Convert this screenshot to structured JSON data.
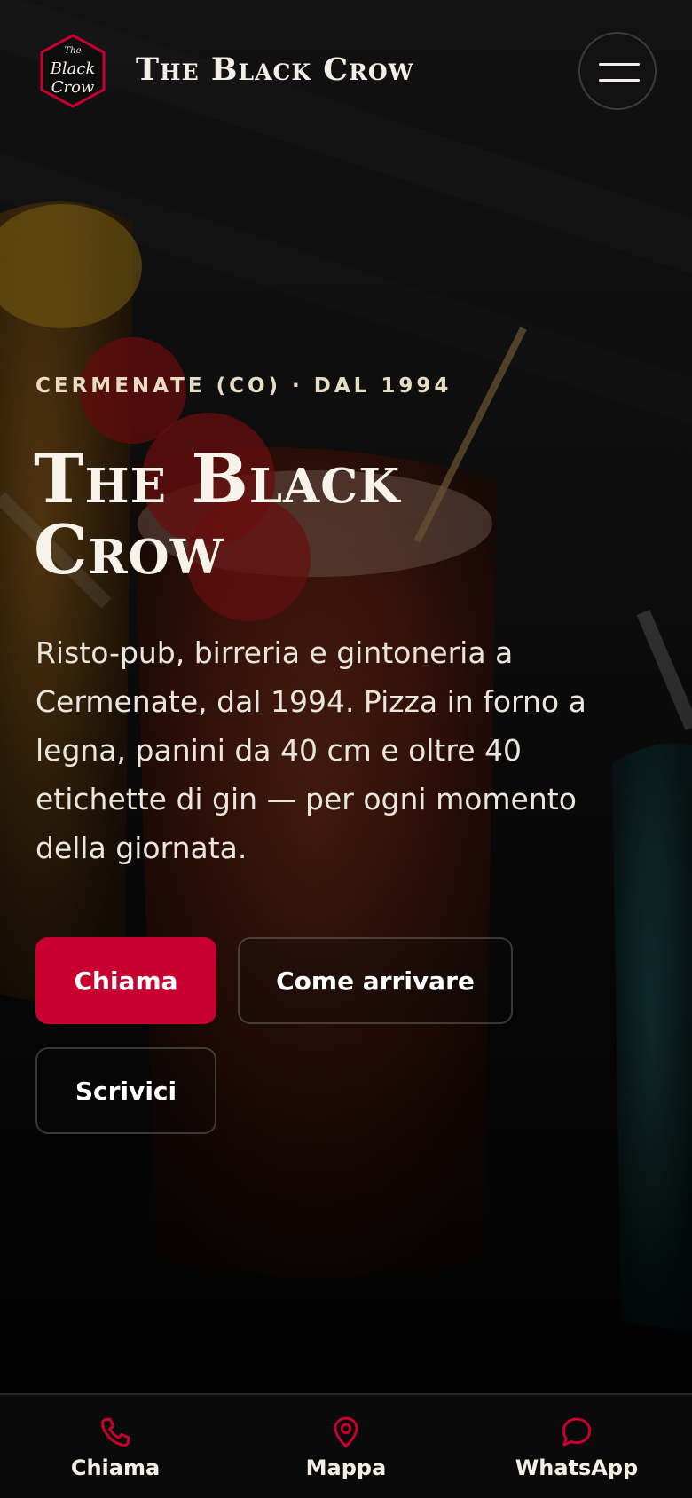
{
  "header": {
    "logo_text_small": "The",
    "logo_text_line1": "Black",
    "logo_text_line2": "Crow",
    "brand": "The Black Crow",
    "menu_icon": "hamburger-menu-icon"
  },
  "hero": {
    "kicker": "CERMENATE (CO) · DAL 1994",
    "title_line1": "The Black",
    "title_line2": "Crow",
    "description": "Risto-pub, birreria e gintoneria a Cermenate, dal 1994. Pizza in forno a legna, panini da 40 cm e oltre 40 etichette di gin — per ogni momento della giornata.",
    "buttons": {
      "call": "Chiama",
      "directions": "Come arrivare",
      "write": "Scrivici"
    }
  },
  "bottom_bar": {
    "items": [
      {
        "label": "Chiama",
        "icon": "phone-icon"
      },
      {
        "label": "Mappa",
        "icon": "map-pin-icon"
      },
      {
        "label": "WhatsApp",
        "icon": "chat-bubble-icon"
      }
    ]
  },
  "colors": {
    "accent": "#c8002f",
    "text": "#f3efe6",
    "kicker": "#e8dcc3",
    "background": "#0b0b0b"
  }
}
